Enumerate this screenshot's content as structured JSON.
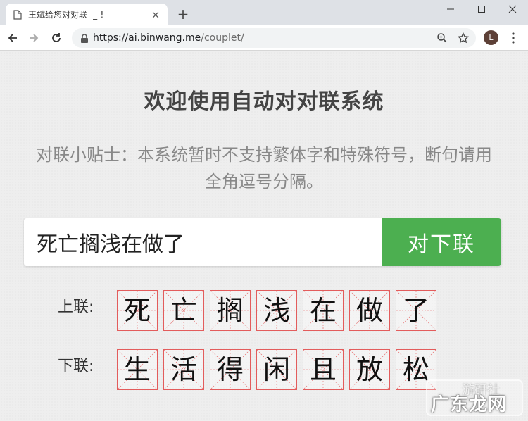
{
  "browser": {
    "tab_title": "王斌给您对对联 -_-!",
    "tab_close": "×",
    "new_tab": "+",
    "url_host": "https://ai.binwang.me",
    "url_path": "/couplet/",
    "profile_initial": "L"
  },
  "page": {
    "title": "欢迎使用自动对对联系统",
    "tip_line1": "对联小贴士：本系统暂时不支持繁体字和特殊符号，断句请用",
    "tip_line2": "全角逗号分隔。",
    "input_value": "死亡搁浅在做了",
    "submit_label": "对下联",
    "upper_label": "上联:",
    "lower_label": "下联:",
    "upper_chars": [
      "死",
      "亡",
      "搁",
      "浅",
      "在",
      "做",
      "了"
    ],
    "lower_chars": [
      "生",
      "活",
      "得",
      "闲",
      "且",
      "放",
      "松"
    ]
  },
  "watermark": {
    "text": "广东龙网",
    "faint_text": "游研社"
  },
  "colors": {
    "accent_green": "#4caf50",
    "grid_red": "#e35c5c"
  }
}
